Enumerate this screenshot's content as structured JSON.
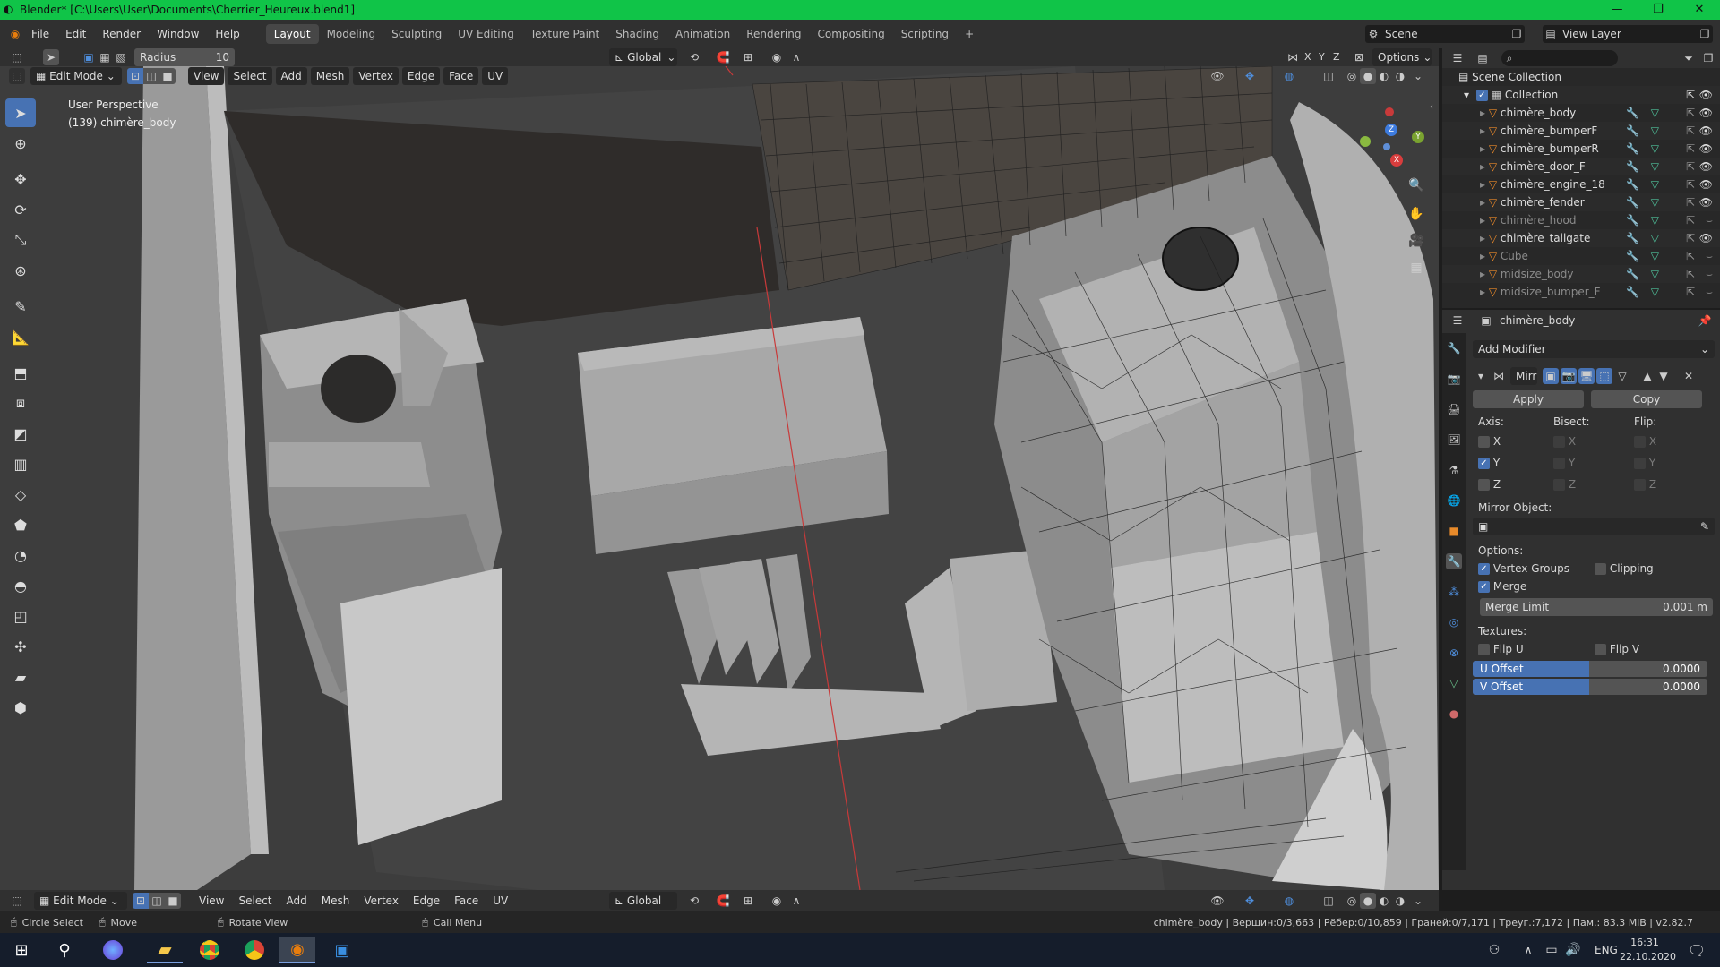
{
  "window": {
    "title": "Blender* [C:\\Users\\User\\Documents\\Cherrier_Heureux.blend1]",
    "controls": {
      "minimize": "—",
      "maximize": "❐",
      "close": "✕"
    }
  },
  "menubar": {
    "items": [
      "File",
      "Edit",
      "Render",
      "Window",
      "Help"
    ],
    "workspaces": [
      "Layout",
      "Modeling",
      "Sculpting",
      "UV Editing",
      "Texture Paint",
      "Shading",
      "Animation",
      "Rendering",
      "Compositing",
      "Scripting",
      "+"
    ],
    "active_workspace": "Layout",
    "scene": "Scene",
    "view_layer": "View Layer"
  },
  "tool_header": {
    "radius_label": "Radius",
    "radius_value": "10",
    "orientation": "Global",
    "options": "Options",
    "axes": [
      "X",
      "Y",
      "Z"
    ]
  },
  "viewport_header": {
    "mode": "Edit Mode",
    "menus": [
      "View",
      "Select",
      "Add",
      "Mesh",
      "Vertex",
      "Edge",
      "Face",
      "UV"
    ]
  },
  "viewport": {
    "perspective": "User Perspective",
    "object_info": "(139) chimère_body",
    "gizmo_axes": [
      "X",
      "Y",
      "Z"
    ]
  },
  "bottom_header": {
    "mode": "Edit Mode",
    "menus": [
      "View",
      "Select",
      "Add",
      "Mesh",
      "Vertex",
      "Edge",
      "Face",
      "UV"
    ],
    "orientation": "Global"
  },
  "outliner": {
    "root": "Scene Collection",
    "collection": "Collection",
    "items": [
      {
        "name": "chimère_body",
        "visible": true
      },
      {
        "name": "chimère_bumperF",
        "visible": true
      },
      {
        "name": "chimère_bumperR",
        "visible": true
      },
      {
        "name": "chimère_door_F",
        "visible": true
      },
      {
        "name": "chimère_engine_18",
        "visible": true
      },
      {
        "name": "chimère_fender",
        "visible": true
      },
      {
        "name": "chimère_hood",
        "visible": false
      },
      {
        "name": "chimère_tailgate",
        "visible": true
      },
      {
        "name": "Cube",
        "visible": false
      },
      {
        "name": "midsize_body",
        "visible": false
      },
      {
        "name": "midsize_bumper_F",
        "visible": false
      }
    ]
  },
  "properties": {
    "object_name": "chimère_body",
    "add_modifier": "Add Modifier",
    "modifier_name": "Mirr",
    "apply": "Apply",
    "copy": "Copy",
    "axis_label": "Axis:",
    "bisect_label": "Bisect:",
    "flip_label": "Flip:",
    "axes": [
      {
        "axis": "X",
        "axis_on": false,
        "bisect": "X",
        "flip": "X"
      },
      {
        "axis": "Y",
        "axis_on": true,
        "bisect": "Y",
        "flip": "Y"
      },
      {
        "axis": "Z",
        "axis_on": false,
        "bisect": "Z",
        "flip": "Z"
      }
    ],
    "mirror_object_label": "Mirror Object:",
    "options_label": "Options:",
    "vertex_groups": "Vertex Groups",
    "clipping": "Clipping",
    "merge": "Merge",
    "merge_limit_label": "Merge Limit",
    "merge_limit_value": "0.001 m",
    "textures_label": "Textures:",
    "flip_u": "Flip U",
    "flip_v": "Flip V",
    "u_offset_label": "U Offset",
    "u_offset_value": "0.0000",
    "v_offset_label": "V Offset",
    "v_offset_value": "0.0000"
  },
  "statusbar": {
    "left": [
      "Circle Select",
      "Move",
      "Rotate View",
      "Call Menu"
    ],
    "right": "chimère_body | Вершин:0/3,663 | Рёбер:0/10,859 | Граней:0/7,171 | Треуг.:7,172 | Пам.: 83.3 MiB | v2.82.7"
  },
  "taskbar": {
    "time": "16:31",
    "date": "22.10.2020",
    "lang": "ENG"
  }
}
